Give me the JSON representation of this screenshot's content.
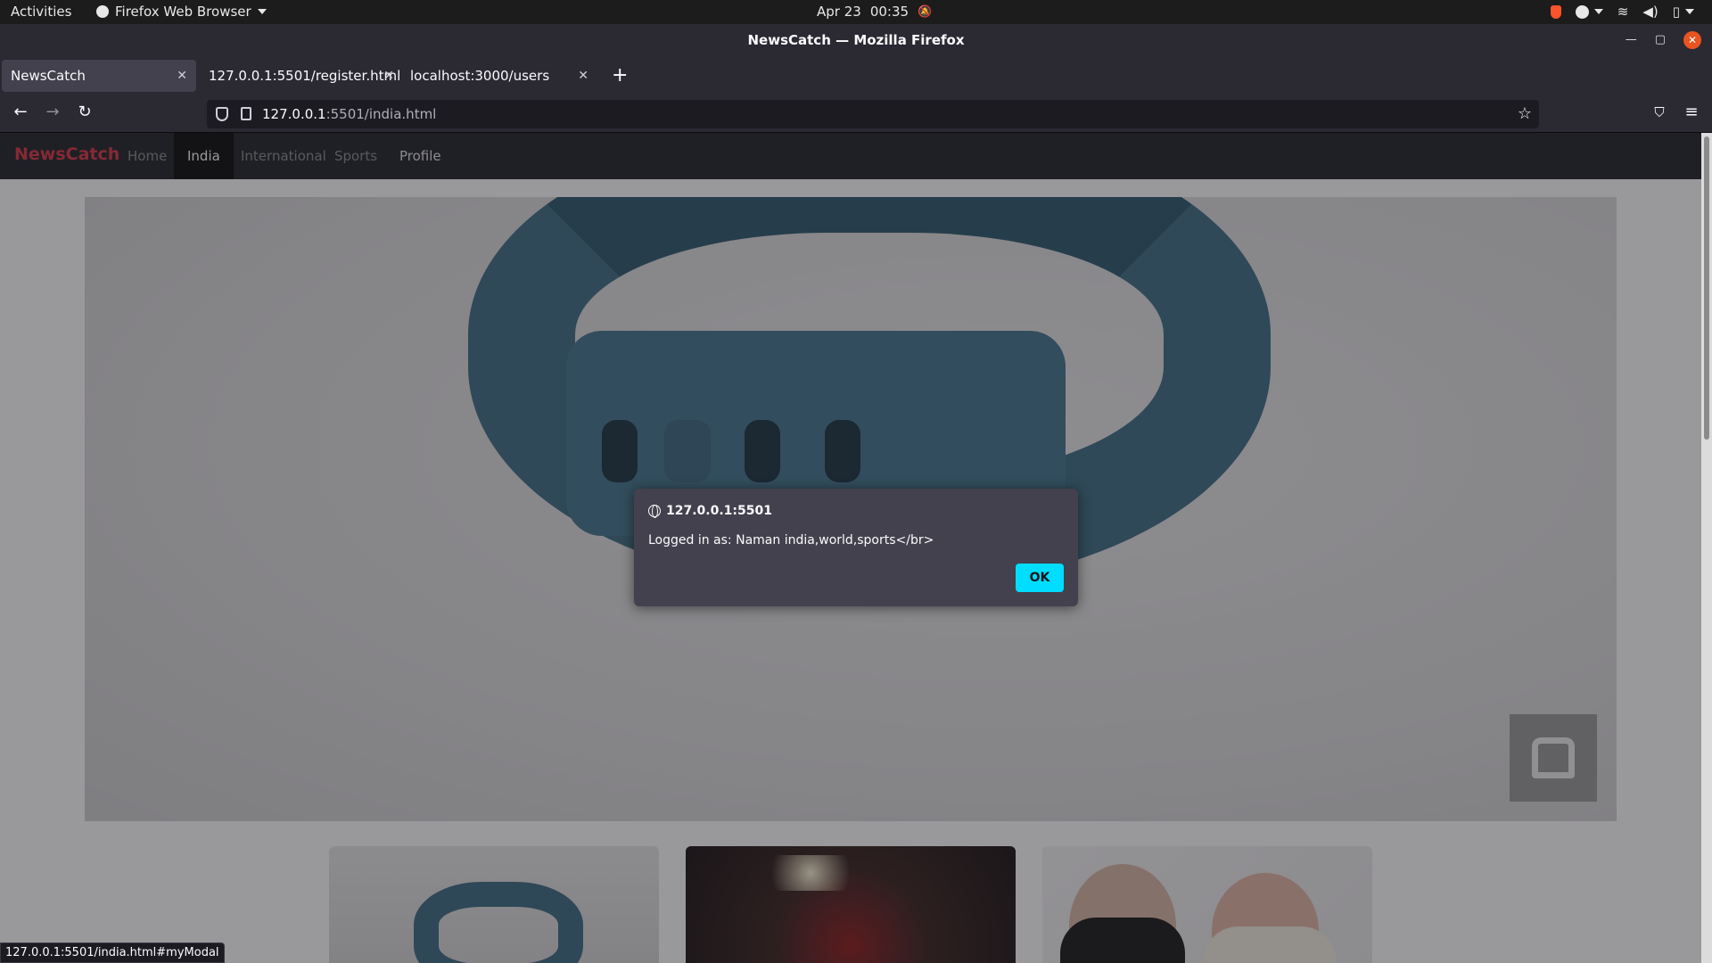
{
  "system_bar": {
    "activities": "Activities",
    "app_menu": "Firefox Web Browser",
    "date": "Apr 23",
    "time": "00:35"
  },
  "window": {
    "title": "NewsCatch — Mozilla Firefox"
  },
  "tabs": [
    {
      "label": "NewsCatch",
      "active": true
    },
    {
      "label": "127.0.0.1:5501/register.html",
      "active": false
    },
    {
      "label": "localhost:3000/users",
      "active": false
    }
  ],
  "urlbar": {
    "host": "127.0.0.1",
    "path": ":5501/india.html"
  },
  "site": {
    "brand": "NewsCatch",
    "nav": [
      {
        "label": "Home"
      },
      {
        "label": "India",
        "active": true
      },
      {
        "label": "International"
      },
      {
        "label": "Sports"
      },
      {
        "label": "Profile"
      }
    ]
  },
  "dialog": {
    "origin": "127.0.0.1:5501",
    "message": "Logged in as: Naman india,world,sports</br>",
    "ok_label": "OK"
  },
  "status_bar": {
    "url": "127.0.0.1:5501/india.html#myModal"
  },
  "colors": {
    "brand": "#dc3545",
    "dialog_bg": "#42414d",
    "ok_button": "#00ddff"
  }
}
